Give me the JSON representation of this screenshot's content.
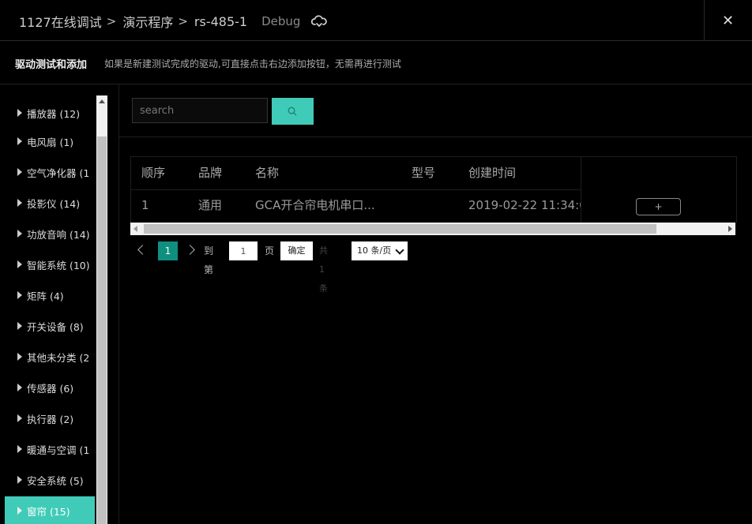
{
  "header": {
    "breadcrumb": [
      "1127在线调试",
      "演示程序",
      "rs-485-1"
    ],
    "breadcrumb_sep": ">",
    "mode": "Debug",
    "close_label": "✕"
  },
  "subheader": {
    "title": "驱动测试和添加",
    "description": "如果是新建测试完成的驱动,可直接点击右边添加按钮，无需再进行测试"
  },
  "sidebar": {
    "items": [
      {
        "label": "播放器 (12)"
      },
      {
        "label": "电风扇 (1)"
      },
      {
        "label": "空气净化器 (1"
      },
      {
        "label": "投影仪 (14)"
      },
      {
        "label": "功放音响 (14)"
      },
      {
        "label": "智能系统 (10)"
      },
      {
        "label": "矩阵 (4)"
      },
      {
        "label": "开关设备 (8)"
      },
      {
        "label": "其他未分类 (2"
      },
      {
        "label": "传感器 (6)"
      },
      {
        "label": "执行器 (2)"
      },
      {
        "label": "暖通与空调 (1"
      },
      {
        "label": "安全系统 (5)"
      },
      {
        "label": "窗帘 (15)"
      }
    ],
    "active_index": 13
  },
  "search": {
    "placeholder": "search"
  },
  "table": {
    "columns": [
      "顺序",
      "品牌",
      "名称",
      "型号",
      "创建时间"
    ],
    "rows": [
      {
        "order": "1",
        "brand": "通用",
        "name": "GCA开合帘电机串口...",
        "model": "",
        "created": "2019-02-22 11:34:0"
      }
    ],
    "add_label": "+"
  },
  "pagination": {
    "current": "1",
    "goto_label": "到第",
    "goto_value": "1",
    "page_label": "页",
    "confirm_label": "确定",
    "total": "共 1 条",
    "page_size": "10 条/页"
  },
  "colors": {
    "accent": "#40cbb8",
    "page_active": "#0e8f80",
    "background": "#000000"
  }
}
